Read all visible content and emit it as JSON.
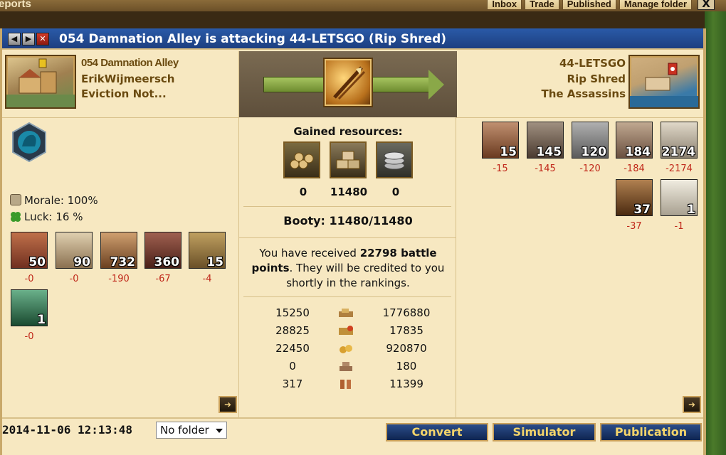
{
  "top": {
    "title": "eports",
    "tabs": [
      "Inbox",
      "Trade",
      "Published",
      "Manage folder"
    ],
    "close": "X"
  },
  "window": {
    "title": "054 Damnation Alley is attacking 44-LETSGO (Rip Shred)",
    "nav": [
      "◀",
      "▶",
      "✕"
    ]
  },
  "attacker": {
    "city": "054 Damnation Alley",
    "player": "ErikWijmeersch",
    "alliance": "Eviction Not...",
    "morale_label": "Morale: 100%",
    "luck_label": "Luck: 16 %",
    "units": [
      {
        "icon": "fire-ship-icon",
        "count": "50",
        "loss": "-0",
        "color": "#b0502a"
      },
      {
        "icon": "transport-boat-icon",
        "count": "90",
        "loss": "-0",
        "color": "#a89070"
      },
      {
        "icon": "hoplite-icon",
        "count": "732",
        "loss": "-190",
        "color": "#8a5a30"
      },
      {
        "icon": "chariot-icon",
        "count": "360",
        "loss": "-67",
        "color": "#7a3a2a"
      },
      {
        "icon": "catapult-icon",
        "count": "15",
        "loss": "-4",
        "color": "#8a7040"
      },
      {
        "icon": "medusa-icon",
        "count": "1",
        "loss": "-0",
        "color": "#3a7a5a"
      }
    ]
  },
  "defender": {
    "city": "44-LETSGO",
    "player": "Rip Shred",
    "alliance": "The Assassins",
    "units": [
      {
        "icon": "horseman-icon",
        "count": "15",
        "loss": "-15",
        "color": "#8a5a3a"
      },
      {
        "icon": "hoplite-icon",
        "count": "145",
        "loss": "-145",
        "color": "#6a5a50"
      },
      {
        "icon": "archer-icon",
        "count": "120",
        "loss": "-120",
        "color": "#7a7a7a"
      },
      {
        "icon": "swordsman-icon",
        "count": "184",
        "loss": "-184",
        "color": "#8a7060"
      },
      {
        "icon": "bireme-icon",
        "count": "2174",
        "loss": "-2174",
        "color": "#b0a890"
      },
      {
        "icon": "minotaur-icon",
        "count": "37",
        "loss": "-37",
        "color": "#7a4a2a"
      },
      {
        "icon": "pegasus-icon",
        "count": "1",
        "loss": "-1",
        "color": "#d8d0c0"
      }
    ]
  },
  "center": {
    "gained_title": "Gained resources:",
    "resources": [
      {
        "icon": "wood-icon",
        "value": "0"
      },
      {
        "icon": "stone-icon",
        "value": "11480"
      },
      {
        "icon": "silver-icon",
        "value": "0"
      }
    ],
    "booty": "Booty: 11480/11480",
    "bp_pre": "You have received ",
    "bp_bold": "22798 battle points",
    "bp_post": ". They will be credited to you shortly in the rankings.",
    "table": [
      {
        "left": "15250",
        "icon": "resources-lost-icon",
        "right": "1776880"
      },
      {
        "left": "28825",
        "icon": "units-lost-icon",
        "right": "17835"
      },
      {
        "left": "22450",
        "icon": "gold-icon",
        "right": "920870"
      },
      {
        "left": "0",
        "icon": "bricks-icon",
        "right": "180"
      },
      {
        "left": "317",
        "icon": "population-icon",
        "right": "11399"
      }
    ]
  },
  "footer": {
    "date": "2014-11-06 12:13:48",
    "folder": "No folder",
    "buttons": [
      "Convert",
      "Simulator",
      "Publication"
    ]
  }
}
